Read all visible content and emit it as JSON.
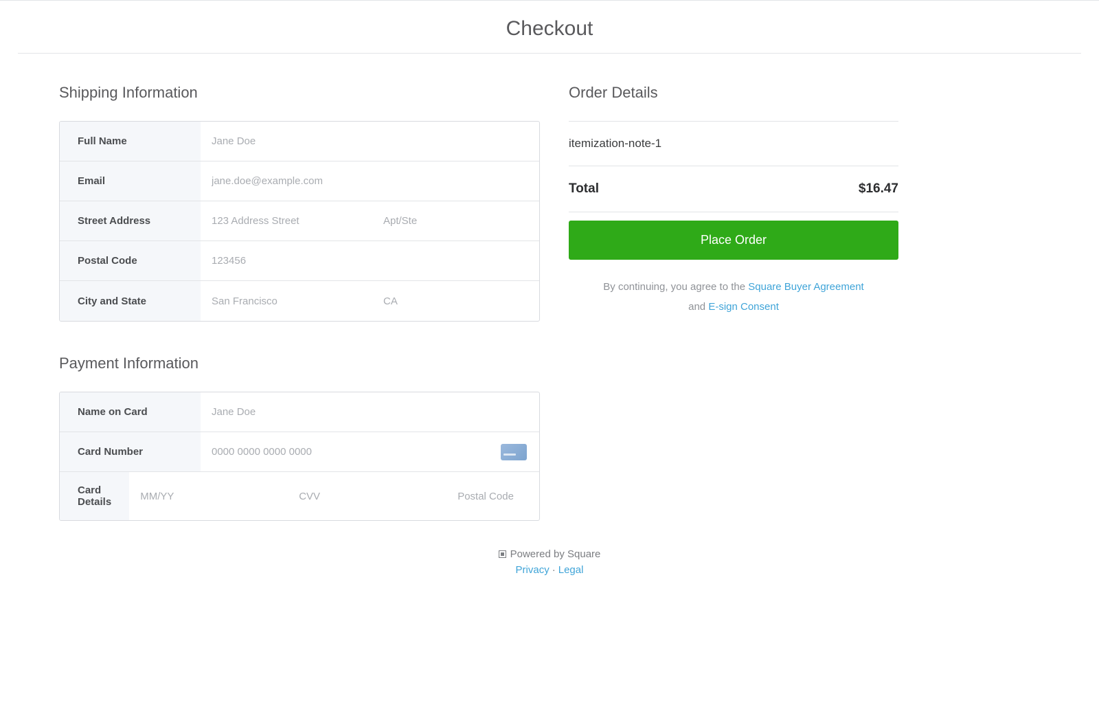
{
  "title": "Checkout",
  "shipping": {
    "heading": "Shipping Information",
    "full_name_label": "Full Name",
    "full_name_placeholder": "Jane Doe",
    "email_label": "Email",
    "email_placeholder": "jane.doe@example.com",
    "street_label": "Street Address",
    "street_placeholder": "123 Address Street",
    "apt_placeholder": "Apt/Ste",
    "postal_label": "Postal Code",
    "postal_placeholder": "123456",
    "citystate_label": "City and State",
    "city_placeholder": "San Francisco",
    "state_placeholder": "CA"
  },
  "payment": {
    "heading": "Payment Information",
    "name_on_card_label": "Name on Card",
    "name_on_card_placeholder": "Jane Doe",
    "card_number_label": "Card Number",
    "card_number_placeholder": "0000 0000 0000 0000",
    "card_details_label": "Card Details",
    "exp_placeholder": "MM/YY",
    "cvv_placeholder": "CVV",
    "zip_placeholder": "Postal Code"
  },
  "order": {
    "heading": "Order Details",
    "item_note": "itemization-note-1",
    "total_label": "Total",
    "total_value": "$16.47",
    "place_order_label": "Place Order",
    "agree_prefix": "By continuing, you agree to the ",
    "agree_link1": "Square Buyer Agreement",
    "agree_middle": " and ",
    "agree_link2": "E-sign Consent"
  },
  "footer": {
    "powered": "Powered by Square",
    "privacy": "Privacy",
    "legal": "Legal"
  }
}
